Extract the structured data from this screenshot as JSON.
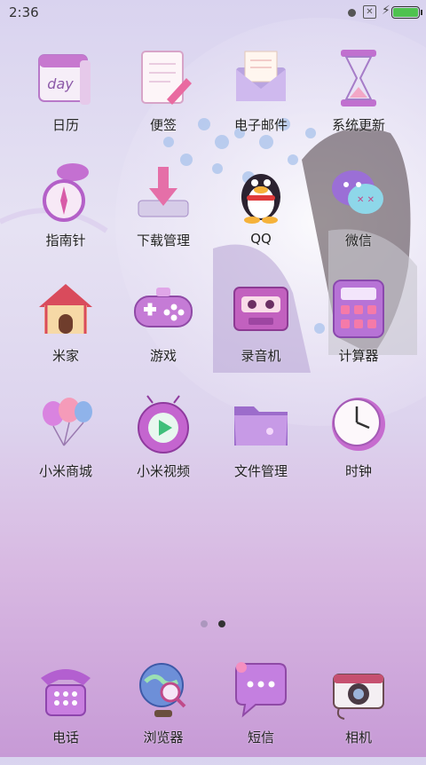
{
  "status_bar": {
    "time": "2:36"
  },
  "apps": [
    {
      "label": "日历",
      "icon": "calendar-icon",
      "icon_text": "day"
    },
    {
      "label": "便签",
      "icon": "notes-icon"
    },
    {
      "label": "电子邮件",
      "icon": "email-icon"
    },
    {
      "label": "系统更新",
      "icon": "hourglass-icon"
    },
    {
      "label": "指南针",
      "icon": "compass-icon"
    },
    {
      "label": "下载管理",
      "icon": "download-icon"
    },
    {
      "label": "QQ",
      "icon": "qq-penguin-icon"
    },
    {
      "label": "微信",
      "icon": "wechat-icon"
    },
    {
      "label": "米家",
      "icon": "house-icon"
    },
    {
      "label": "游戏",
      "icon": "gamepad-icon"
    },
    {
      "label": "录音机",
      "icon": "cassette-icon"
    },
    {
      "label": "计算器",
      "icon": "calculator-icon"
    },
    {
      "label": "小米商城",
      "icon": "balloons-icon"
    },
    {
      "label": "小米视频",
      "icon": "video-player-icon"
    },
    {
      "label": "文件管理",
      "icon": "folder-icon"
    },
    {
      "label": "时钟",
      "icon": "clock-icon"
    }
  ],
  "dock": [
    {
      "label": "电话",
      "icon": "telephone-icon"
    },
    {
      "label": "浏览器",
      "icon": "globe-browser-icon"
    },
    {
      "label": "短信",
      "icon": "message-bubble-icon"
    },
    {
      "label": "相机",
      "icon": "camera-icon"
    }
  ],
  "page_indicator": {
    "pages": 2,
    "current": 2
  }
}
